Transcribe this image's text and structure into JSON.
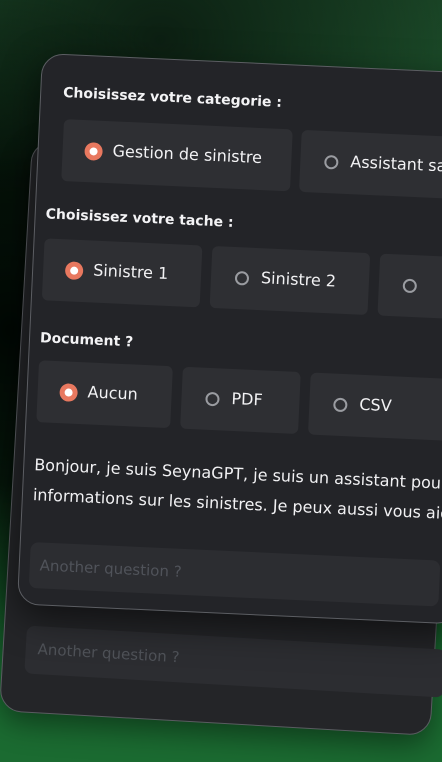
{
  "back_card": {
    "question_placeholder": "Another question ?"
  },
  "form": {
    "category": {
      "label": "Choisissez votre categorie :",
      "options": [
        {
          "label": "Gestion de sinistre",
          "selected": true
        },
        {
          "label": "Assistant sa",
          "selected": false
        }
      ]
    },
    "task": {
      "label": "Choisissez votre tache :",
      "options": [
        {
          "label": "Sinistre 1",
          "selected": true
        },
        {
          "label": "Sinistre 2",
          "selected": false
        },
        {
          "label": "",
          "selected": false
        }
      ]
    },
    "document": {
      "label": "Document ?",
      "options": [
        {
          "label": "Aucun",
          "selected": true
        },
        {
          "label": "PDF",
          "selected": false
        },
        {
          "label": "CSV",
          "selected": false
        }
      ]
    }
  },
  "message": {
    "line1": "Bonjour, je suis SeynaGPT, je suis un assistant pour",
    "line2": "informations sur les sinistres. Je peux aussi vous aid"
  },
  "question": {
    "placeholder": "Another question ?"
  },
  "colors": {
    "accent": "#e8785f",
    "card": "#232428",
    "option_bg": "#2e2f33",
    "background_green": "#1c6b33"
  }
}
